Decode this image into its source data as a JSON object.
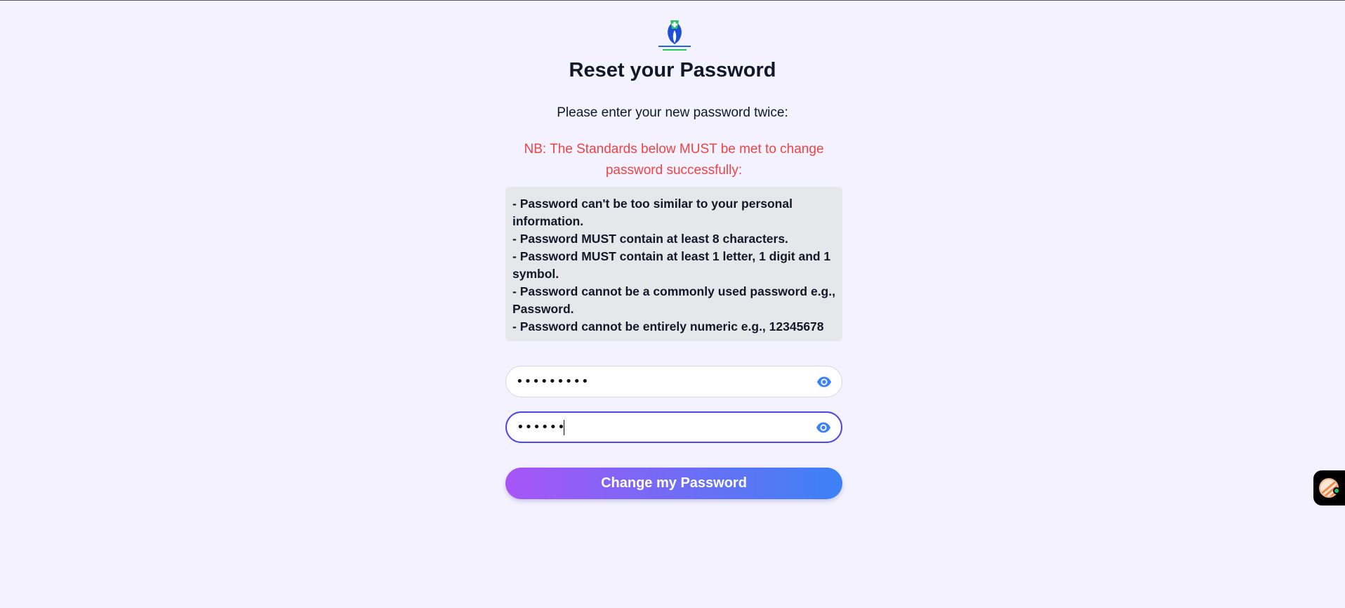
{
  "page": {
    "logo_name": "brand-logo",
    "title": "Reset your Password",
    "subtitle": "Please enter your new password twice:",
    "warning": "NB: The Standards below MUST be met to change password successfully:",
    "rules": [
      "- Password can't be too similar to your personal information.",
      "- Password MUST contain at least 8 characters.",
      "- Password MUST contain at least 1 letter, 1 digit and 1 symbol.",
      "- Password cannot be a commonly used password e.g., Password.",
      "- Password cannot be entirely numeric e.g., 12345678"
    ]
  },
  "form": {
    "new_password": {
      "value": "•••••••••",
      "toggle_icon": "eye-icon"
    },
    "confirm_password": {
      "value": "•••••••••",
      "toggle_icon": "eye-icon"
    },
    "submit_label": "Change my Password"
  },
  "colors": {
    "background": "#f4f2fe",
    "warning": "#ef4444",
    "accent_start": "#a855f7",
    "accent_end": "#3b82f6",
    "focus_border": "#4f46e5",
    "eye": "#3b82f6"
  },
  "widget": {
    "icon": "chat-avatar-icon",
    "status": "online"
  }
}
